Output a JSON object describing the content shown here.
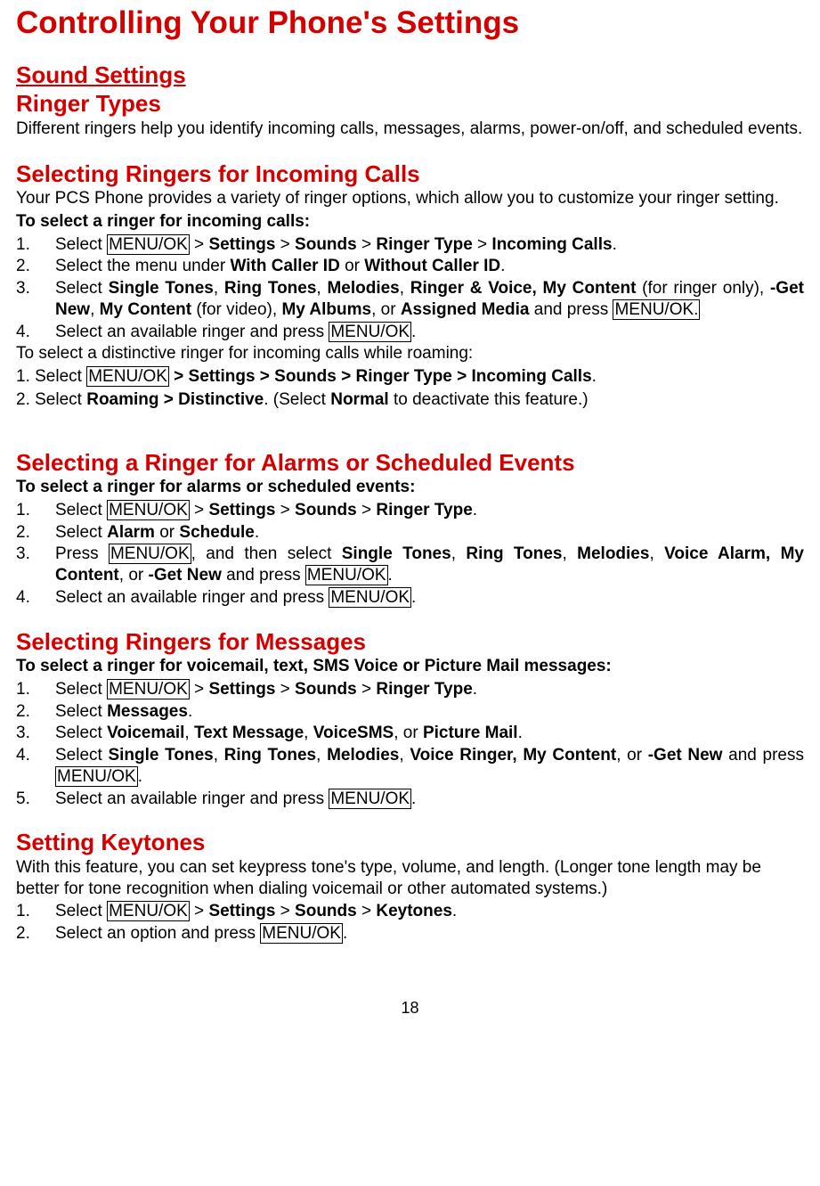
{
  "pageTitle": "Controlling Your Phone's Settings",
  "sectionTitle": "Sound Settings",
  "ringerTypes": {
    "title": "Ringer Types",
    "intro": "Different ringers help you identify incoming calls, messages, alarms, power-on/off, and scheduled events."
  },
  "incoming": {
    "title": "Selecting Ringers for Incoming Calls",
    "intro": "Your PCS Phone provides a variety of ringer options, which allow you to customize your ringer setting.",
    "subhead": "To select a ringer for incoming calls:",
    "roamingIntro": "To select a distinctive ringer for incoming calls while roaming:",
    "step1_a": "Select ",
    "step2_a": "Select the menu under ",
    "step2_b": "With Caller ID",
    "step2_c": " or ",
    "step2_d": "Without Caller ID",
    "step2_e": ".",
    "step3_a": "Select ",
    "step3_b": "Single Tones",
    "step3_c": ", ",
    "step3_d": "Ring Tones",
    "step3_e": ", ",
    "step3_f": "Melodies",
    "step3_g": ", ",
    "step3_h": "Ringer & Voice, My Content",
    "step3_i": " (for ringer only), ",
    "step3_j": "-Get New",
    "step3_k": ", ",
    "step3_l": "My Content",
    "step3_m": " (for video), ",
    "step3_n": "My Albums",
    "step3_o": ", or ",
    "step3_p": "Assigned Media",
    "step3_q": " and press ",
    "step4_a": "Select an available ringer and press ",
    "roam1_a": "1. Select ",
    "roam1_b": " > Settings > Sounds > Ringer Type > Incoming Calls",
    "roam1_c": ".",
    "roam2_a": "2. Select ",
    "roam2_b": "Roaming > Distinctive",
    "roam2_c": ". (Select ",
    "roam2_d": "Normal",
    "roam2_e": " to deactivate this feature.)"
  },
  "alarms": {
    "title": "Selecting a Ringer for Alarms or Scheduled Events",
    "subhead": "To select a ringer for alarms or scheduled events:",
    "step1_a": "Select ",
    "step2_a": "Select ",
    "step2_b": "Alarm",
    "step2_c": " or ",
    "step2_d": "Schedule",
    "step2_e": ".",
    "step3_a": "Press ",
    "step3_b": ", and then select ",
    "step3_c": "Single Tones",
    "step3_d": ", ",
    "step3_e": "Ring Tones",
    "step3_f": ", ",
    "step3_g": "Melodies",
    "step3_h": ", ",
    "step3_i": "Voice Alarm, My Content",
    "step3_j": ", or ",
    "step3_k": "-Get New",
    "step3_l": " and press ",
    "step4_a": "Select an available ringer and press "
  },
  "messages": {
    "title": "Selecting Ringers for Messages",
    "subhead": "To select a ringer for voicemail, text, SMS Voice or Picture Mail messages:",
    "step1_a": "Select ",
    "step2_a": "Select ",
    "step2_b": "Messages",
    "step2_c": ".",
    "step3_a": "Select ",
    "step3_b": "Voicemail",
    "step3_c": ", ",
    "step3_d": "Text Message",
    "step3_e": ", ",
    "step3_f": "VoiceSMS",
    "step3_g": ", or ",
    "step3_h": "Picture Mail",
    "step3_i": ".",
    "step4_a": "Select ",
    "step4_b": "Single Tones",
    "step4_c": ", ",
    "step4_d": "Ring Tones",
    "step4_e": ", ",
    "step4_f": "Melodies",
    "step4_g": ", ",
    "step4_h": "Voice Ringer, My Content",
    "step4_i": ", or ",
    "step4_j": "-Get New",
    "step4_k": " and press ",
    "step5_a": "Select an available ringer and press "
  },
  "keytones": {
    "title": "Setting Keytones",
    "intro": "With this feature, you can set keypress tone's type, volume, and length. (Longer tone length may be better for tone recognition when dialing voicemail or other automated systems.)",
    "step1_a": "Select ",
    "step2_a": "Select an option and press "
  },
  "common": {
    "menuOk": "MENU/OK",
    "menuOkDot": "MENU/OK.",
    "gt": " > ",
    "settings": "Settings",
    "sounds": "Sounds",
    "ringerType": "Ringer Type",
    "incomingCalls": "Incoming Calls",
    "keytones": "Keytones",
    "dot": "."
  },
  "pageNumber": "18"
}
